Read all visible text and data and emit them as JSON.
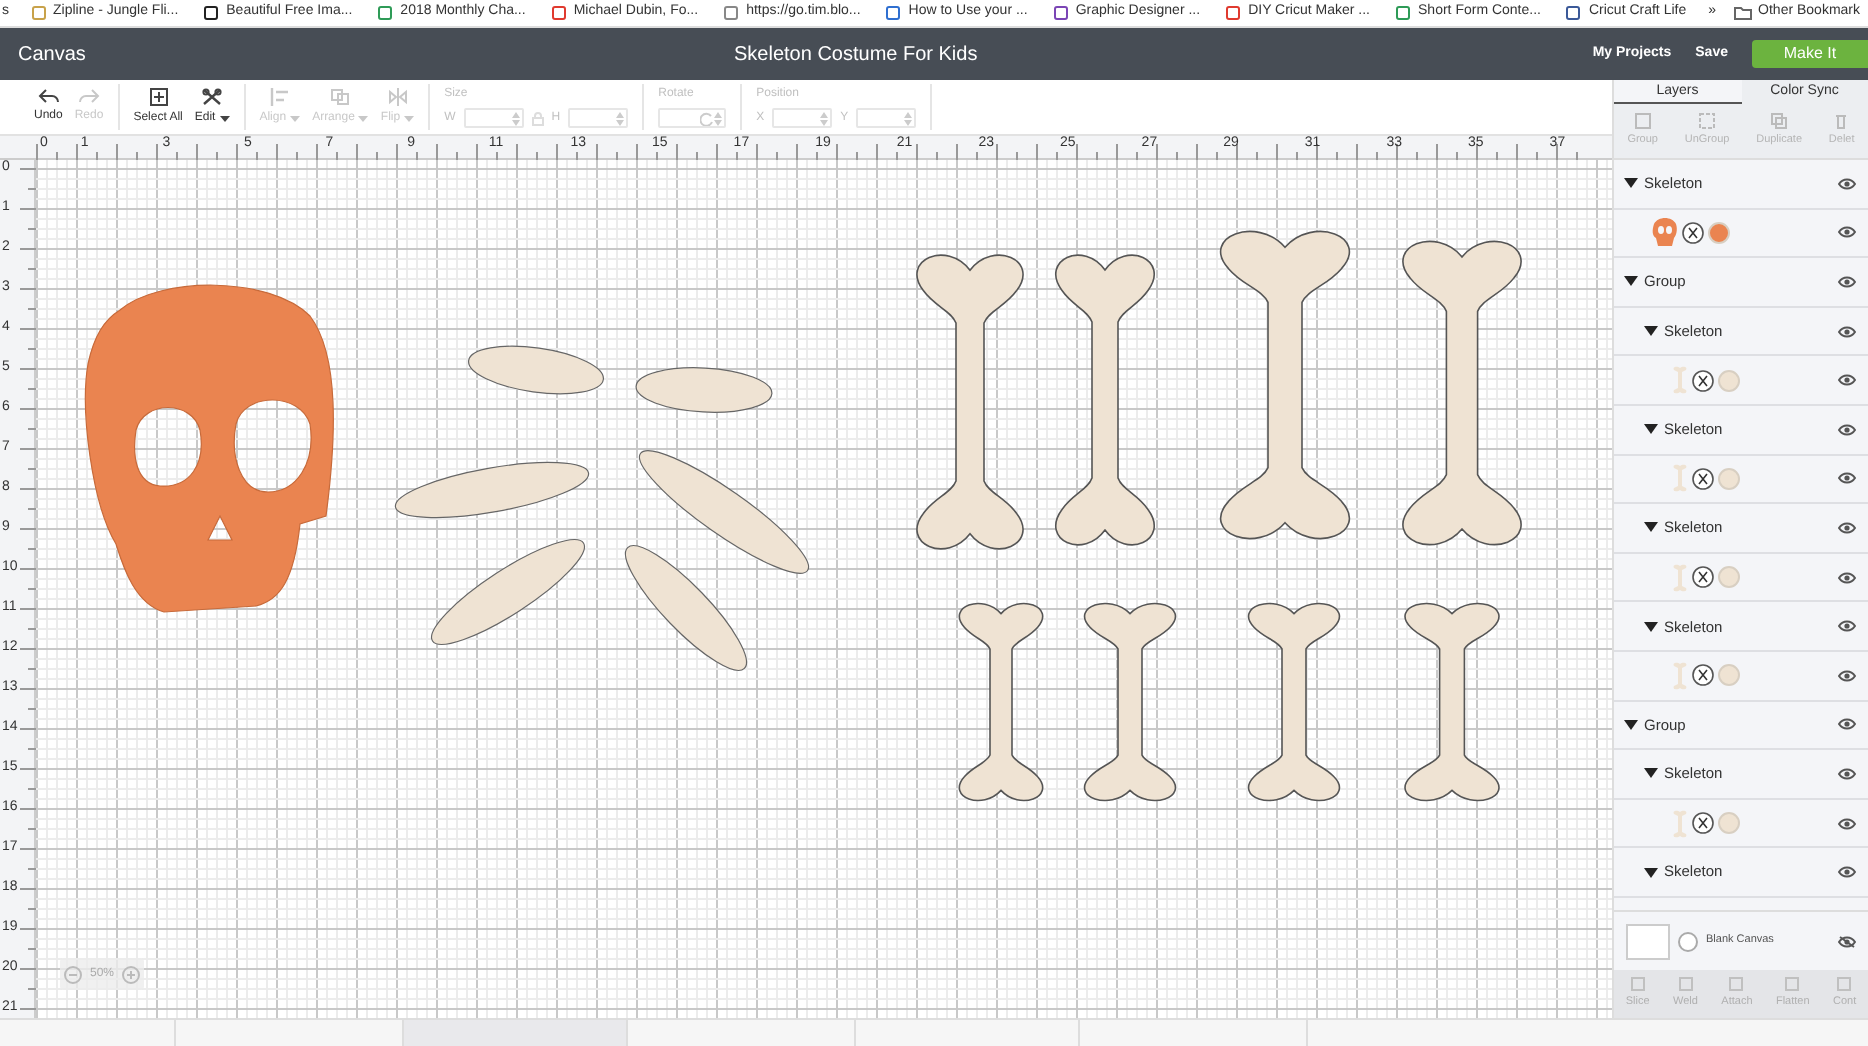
{
  "bookmarks_bar": {
    "cut_label": "s",
    "items": [
      {
        "label": "Zipline - Jungle Fli..."
      },
      {
        "label": "Beautiful Free Ima..."
      },
      {
        "label": "2018 Monthly Cha..."
      },
      {
        "label": "Michael Dubin, Fo..."
      },
      {
        "label": "https://go.tim.blo..."
      },
      {
        "label": "How to Use your ..."
      },
      {
        "label": "Graphic Designer ..."
      },
      {
        "label": "DIY Cricut Maker ..."
      },
      {
        "label": "Short Form Conte..."
      },
      {
        "label": "Cricut Craft Life"
      }
    ],
    "more": "»",
    "other": "Other Bookmark"
  },
  "header": {
    "app": "Canvas",
    "title": "Skeleton Costume For Kids",
    "links": [
      "My Projects",
      "Save"
    ],
    "primary_button": "Make It"
  },
  "toolbar": {
    "tools": [
      {
        "label": "Undo",
        "kind": "undo",
        "disabled": false,
        "dropdown": false
      },
      {
        "label": "Redo",
        "kind": "redo",
        "disabled": true,
        "dropdown": false
      },
      {
        "label": "Select All",
        "kind": "select",
        "disabled": false,
        "dropdown": false
      },
      {
        "label": "Edit",
        "kind": "edit",
        "disabled": false,
        "dropdown": true
      },
      {
        "label": "Align",
        "kind": "align",
        "disabled": true,
        "dropdown": true
      },
      {
        "label": "Arrange",
        "kind": "arrange",
        "disabled": true,
        "dropdown": true
      },
      {
        "label": "Flip",
        "kind": "flip",
        "disabled": true,
        "dropdown": true
      }
    ],
    "size": {
      "label": "Size",
      "fields": [
        "W",
        "H"
      ]
    },
    "rotate": {
      "label": "Rotate"
    },
    "position": {
      "label": "Position",
      "fields": [
        "X",
        "Y"
      ]
    }
  },
  "canvas": {
    "top_ruler": [
      "0",
      "1",
      "3",
      "5",
      "7",
      "9",
      "11",
      "13",
      "15",
      "17",
      "19",
      "21",
      "23",
      "25",
      "27",
      "29",
      "31",
      "33",
      "35",
      "37"
    ],
    "left_ruler": [
      "0",
      "1",
      "2",
      "3",
      "4",
      "5",
      "6",
      "7",
      "8",
      "9",
      "10",
      "11",
      "12",
      "13",
      "14",
      "15",
      "16",
      "17",
      "18",
      "19",
      "20",
      "21"
    ],
    "zoom": "50%"
  },
  "panel": {
    "tabs": [
      {
        "label": "Layers",
        "selected": true
      },
      {
        "label": "Color Sync",
        "selected": false
      }
    ],
    "actions": [
      "Group",
      "UnGroup",
      "Duplicate",
      "Delet"
    ],
    "layers": [
      {
        "label": "Skeleton",
        "expanded": true,
        "children": [
          {
            "kind": "skull",
            "color": "#ea8450"
          }
        ]
      },
      {
        "label": "Group",
        "expanded": true,
        "children": [
          {
            "label": "Skeleton",
            "expanded": true,
            "children": [
              {
                "kind": "bone",
                "color": "#efe3d3"
              }
            ]
          },
          {
            "label": "Skeleton",
            "expanded": true,
            "children": [
              {
                "kind": "bone",
                "color": "#efe3d3"
              }
            ]
          },
          {
            "label": "Skeleton",
            "expanded": true,
            "children": [
              {
                "kind": "bone",
                "color": "#efe3d3"
              }
            ]
          },
          {
            "label": "Skeleton",
            "expanded": true,
            "children": [
              {
                "kind": "bone",
                "color": "#efe3d3"
              }
            ]
          }
        ]
      },
      {
        "label": "Group",
        "expanded": true,
        "children": [
          {
            "label": "Skeleton",
            "expanded": true,
            "children": [
              {
                "kind": "bone",
                "color": "#efe3d3"
              }
            ]
          },
          {
            "label": "Skeleton",
            "expanded": true
          }
        ]
      }
    ],
    "blank_canvas": {
      "label": "Blank Canvas",
      "visible": false
    },
    "bottom_tools": [
      "Slice",
      "Weld",
      "Attach",
      "Flatten",
      "Cont"
    ]
  }
}
